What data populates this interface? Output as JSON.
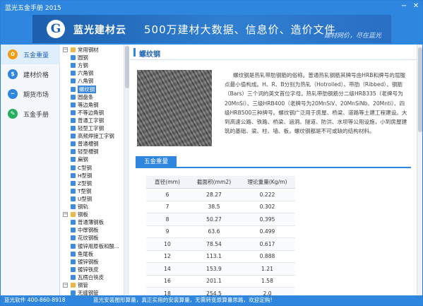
{
  "window": {
    "title": "蓝光五金手册 2015"
  },
  "banner": {
    "logo_letter": "G",
    "brand": "蓝光建材云",
    "slogan": "500万建材大数据、信息价、造价文件",
    "motto": "建材网价，尽在蓝光"
  },
  "nav": {
    "items": [
      {
        "label": "五金重量",
        "icon": "tools-icon",
        "color": "#f39c12"
      },
      {
        "label": "建材价格",
        "icon": "dollar-icon",
        "color": "#2e86de"
      },
      {
        "label": "期货市场",
        "icon": "chart-icon",
        "color": "#2e86de"
      },
      {
        "label": "五金手册",
        "icon": "wrench-icon",
        "color": "#27ae60"
      }
    ]
  },
  "tree": {
    "rows": [
      {
        "text": "常用钢材",
        "level": 0,
        "toggle": "−",
        "type": "folder"
      },
      {
        "text": "圆钢",
        "level": 1,
        "type": "leaf"
      },
      {
        "text": "方钢",
        "level": 1,
        "type": "leaf"
      },
      {
        "text": "六角钢",
        "level": 1,
        "type": "leaf"
      },
      {
        "text": "八角钢",
        "level": 1,
        "type": "leaf"
      },
      {
        "text": "螺纹钢",
        "level": 1,
        "type": "leaf",
        "selected": true
      },
      {
        "text": "圆盘条",
        "level": 1,
        "type": "leaf"
      },
      {
        "text": "等边角钢",
        "level": 1,
        "type": "leaf"
      },
      {
        "text": "不等边角钢",
        "level": 1,
        "type": "leaf"
      },
      {
        "text": "普通工字钢",
        "level": 1,
        "type": "leaf"
      },
      {
        "text": "轻型工字钢",
        "level": 1,
        "type": "leaf"
      },
      {
        "text": "高频焊接工字钢",
        "level": 1,
        "type": "leaf"
      },
      {
        "text": "普通槽钢",
        "level": 1,
        "type": "leaf"
      },
      {
        "text": "轻型槽钢",
        "level": 1,
        "type": "leaf"
      },
      {
        "text": "扁钢",
        "level": 1,
        "type": "leaf"
      },
      {
        "text": "C型钢",
        "level": 1,
        "type": "leaf"
      },
      {
        "text": "H型钢",
        "level": 1,
        "type": "leaf"
      },
      {
        "text": "Z型钢",
        "level": 1,
        "type": "leaf"
      },
      {
        "text": "T型钢",
        "level": 1,
        "type": "leaf"
      },
      {
        "text": "U型钢",
        "level": 1,
        "type": "leaf"
      },
      {
        "text": "钢轨",
        "level": 1,
        "type": "leaf"
      },
      {
        "text": "钢板",
        "level": 0,
        "toggle": "−",
        "type": "folder"
      },
      {
        "text": "普通薄钢板",
        "level": 1,
        "type": "leaf"
      },
      {
        "text": "中厚钢板",
        "level": 1,
        "type": "leaf"
      },
      {
        "text": "花纹钢板",
        "level": 1,
        "type": "leaf"
      },
      {
        "text": "镀锌用原板和酸...",
        "level": 1,
        "type": "leaf"
      },
      {
        "text": "鱼尾板",
        "level": 1,
        "type": "leaf"
      },
      {
        "text": "镀锌钢板",
        "level": 1,
        "type": "leaf"
      },
      {
        "text": "镀锌铁皮",
        "level": 1,
        "type": "leaf"
      },
      {
        "text": "瓦楞白铁皮",
        "level": 1,
        "type": "leaf"
      },
      {
        "text": "钢管",
        "level": 0,
        "toggle": "−",
        "type": "folder"
      },
      {
        "text": "无缝钢管",
        "level": 1,
        "type": "leaf"
      }
    ]
  },
  "content": {
    "title": "螺纹钢",
    "description": "螺纹钢是热轧带肋钢筋的俗称。普通热轧钢筋其牌号由HRB和牌号的屈服点最小值构成。H、R、B分别为热轧（Hotrolled）、带肋（Ribbed）、钢筋（Bars）三个词的英文首位字母。热轧带肋钢筋分二级HRB335（老牌号为20MnSi）、三级HRB400（老牌号为20MnSiV、20MnSiNb、20Mnti）、四级HRB500三种牌号。螺纹钢广泛用于房屋、桥梁、道路等土建工程建设。大到高速公路、铁路、桥梁、涵洞、隧道、防洪、水坝等公用设施，小到房屋建筑的基础、梁、柱、墙、板，螺纹钢都是不可或缺的结构材料。",
    "tab": "五金重量",
    "table": {
      "headers": [
        "直径(mm)",
        "截面积(mm2)",
        "理论重量(Kg/m)"
      ],
      "rows": [
        [
          "6",
          "28.27",
          "0.222"
        ],
        [
          "7",
          "38.5",
          "0.302"
        ],
        [
          "8",
          "50.27",
          "0.395"
        ],
        [
          "9",
          "63.6",
          "0.499"
        ],
        [
          "10",
          "78.54",
          "0.617"
        ],
        [
          "12",
          "113.1",
          "0.888"
        ],
        [
          "14",
          "153.9",
          "1.21"
        ],
        [
          "16",
          "201.1",
          "1.58"
        ],
        [
          "18",
          "254.5",
          "2.0"
        ]
      ]
    }
  },
  "status": {
    "left": "蓝光软件 400-860-8918",
    "right": "蓝光安装图形算量，真正实用的安装算量，无需转变原算量思路，欢迎定购!"
  }
}
